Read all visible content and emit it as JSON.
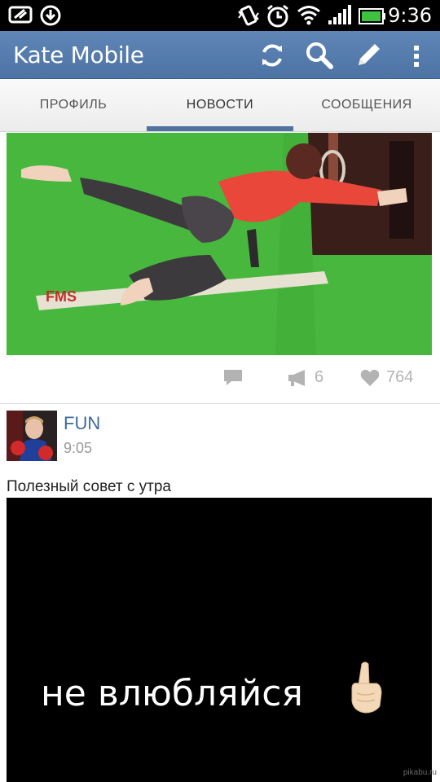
{
  "status_bar": {
    "time": "9:36",
    "icons": [
      "screenshot-icon",
      "download-icon",
      "vibrate-icon",
      "alarm-icon",
      "wifi-icon",
      "signal-icon",
      "battery-icon"
    ]
  },
  "action_bar": {
    "title": "Kate Mobile",
    "actions": [
      "refresh-icon",
      "search-icon",
      "compose-icon",
      "overflow-menu-icon"
    ],
    "color": "#5279a9"
  },
  "tabs": [
    {
      "label": "ПРОФИЛЬ",
      "active": false
    },
    {
      "label": "НОВОСТИ",
      "active": true
    },
    {
      "label": "СООБЩЕНИЯ",
      "active": false
    }
  ],
  "feed": {
    "post1": {
      "image": "exercise-photo",
      "comment_count": "",
      "reposts": "6",
      "likes": "764"
    },
    "post2": {
      "author": "FUN",
      "time": "9:05",
      "text": "Полезный совет с утра",
      "image_text": "не влюбляйся"
    }
  },
  "watermark": "pikabu.ru"
}
